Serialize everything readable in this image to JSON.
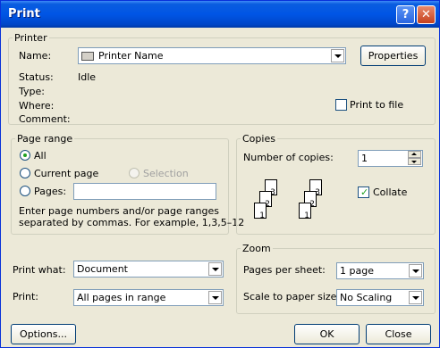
{
  "window": {
    "title": "Print",
    "help_glyph": "?",
    "close_glyph": "✕"
  },
  "printer": {
    "legend": "Printer",
    "name_label": "Name:",
    "name_value": "Printer Name",
    "properties_button": "Properties",
    "status_label": "Status:",
    "status_value": "Idle",
    "type_label": "Type:",
    "where_label": "Where:",
    "comment_label": "Comment:",
    "print_to_file_label": "Print to file",
    "print_to_file_checked": false
  },
  "page_range": {
    "legend": "Page range",
    "all_label": "All",
    "current_page_label": "Current page",
    "selection_label": "Selection",
    "pages_label": "Pages:",
    "pages_value": "",
    "selected": "All",
    "hint_line1": "Enter page numbers and/or page ranges",
    "hint_line2": "separated by commas.  For example, 1,3,5–12"
  },
  "copies": {
    "legend": "Copies",
    "number_label": "Number of copies:",
    "number_value": "1",
    "collate_label": "Collate",
    "collate_checked": true,
    "page_numbers": [
      "3",
      "2",
      "1"
    ]
  },
  "print_what": {
    "label": "Print what:",
    "value": "Document"
  },
  "print_range": {
    "label": "Print:",
    "value": "All pages in range"
  },
  "zoom": {
    "legend": "Zoom",
    "pages_per_sheet_label": "Pages per sheet:",
    "pages_per_sheet_value": "1 page",
    "scale_label": "Scale to paper size:",
    "scale_value": "No Scaling"
  },
  "footer": {
    "options_button": "Options...",
    "ok_button": "OK",
    "close_button": "Close"
  }
}
